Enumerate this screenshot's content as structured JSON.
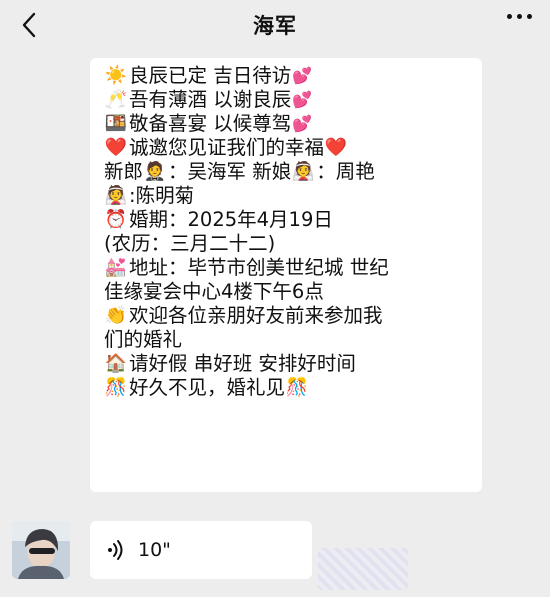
{
  "header": {
    "back_icon": "chevron-left-icon",
    "title": "海军",
    "more_icon": "more-dots-icon"
  },
  "message": {
    "lines": [
      {
        "icon": "☀️",
        "icon_name": "sun-icon",
        "text": "良辰已定 吉日待访",
        "trail": "💕",
        "trail_name": "two-hearts-icon"
      },
      {
        "icon": "🥂",
        "icon_name": "champagne-glasses-icon",
        "text": "吾有薄酒 以谢良辰",
        "trail": "💕",
        "trail_name": "two-hearts-icon"
      },
      {
        "icon": "🍱",
        "icon_name": "feast-box-icon",
        "text": "敬备喜宴 以候尊驾",
        "trail": "💕",
        "trail_name": "two-hearts-icon"
      },
      {
        "icon": "❤️",
        "icon_name": "red-heart-icon",
        "text": "诚邀您见证我们的幸福",
        "trail": "❤️",
        "trail_name": "red-heart-icon"
      },
      {
        "icon": "",
        "icon_name": "",
        "text_a": "新郎",
        "mid_icon": "🤵",
        "mid_icon_name": "groom-icon",
        "text_b": "：吴海军  新娘",
        "mid_icon2": "👰",
        "mid_icon2_name": "bride-icon",
        "text_c": "：周艳"
      },
      {
        "icon": "👰",
        "icon_name": "bride-icon",
        "text": " :陈明菊"
      },
      {
        "icon": "⏰",
        "icon_name": "alarm-clock-icon",
        "text": "婚期：2025年4月19日"
      },
      {
        "icon": "",
        "icon_name": "",
        "text": "(农历：三月二十二)"
      },
      {
        "icon": "💒",
        "icon_name": "wedding-chapel-icon",
        "text": "地址：毕节市创美世纪城 世纪"
      },
      {
        "icon": "",
        "icon_name": "",
        "text": "佳缘宴会中心4楼下午6点"
      },
      {
        "icon": "👏",
        "icon_name": "clapping-hands-icon",
        "text": "欢迎各位亲朋好友前来参加我"
      },
      {
        "icon": "",
        "icon_name": "",
        "text": "们的婚礼"
      },
      {
        "icon": "🏠",
        "icon_name": "house-icon",
        "text": "请好假 串好班 安排好时间"
      },
      {
        "icon": "🎊",
        "icon_name": "confetti-ball-icon",
        "text": "好久不见，婚礼见",
        "trail": "🎊",
        "trail_name": "confetti-ball-icon"
      }
    ]
  },
  "voice_message": {
    "icon": "voice-wave-icon",
    "duration": "10\""
  },
  "colors": {
    "background": "#ededed",
    "bubble": "#ffffff",
    "text": "#111111"
  }
}
